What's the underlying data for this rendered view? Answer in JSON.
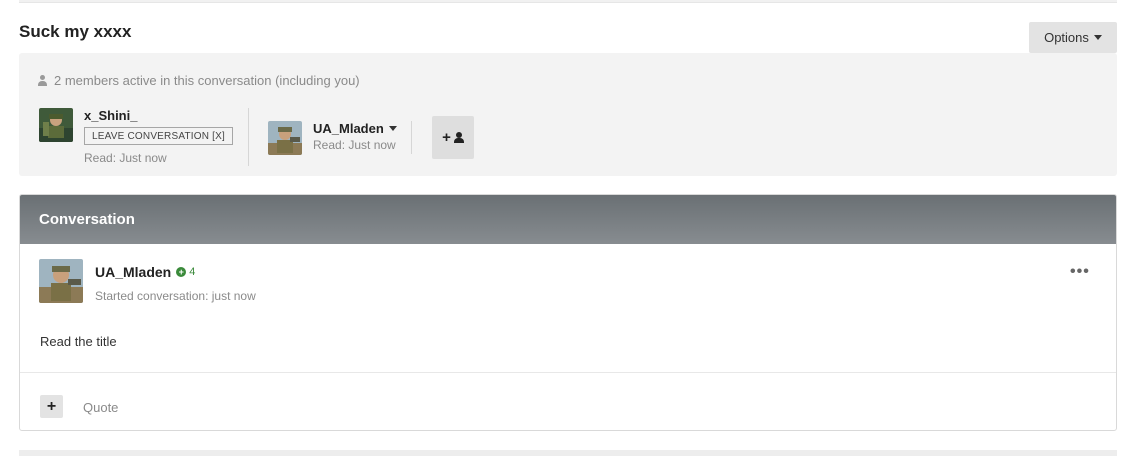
{
  "page": {
    "title": "Suck my xxxx"
  },
  "toolbar": {
    "options_label": "Options"
  },
  "participants": {
    "summary": "2 members active in this conversation (including you)",
    "members": [
      {
        "name": "x_Shini_",
        "action_label": "LEAVE CONVERSATION [X]",
        "read_status": "Read: Just now"
      },
      {
        "name": "UA_Mladen",
        "read_status": "Read: Just now"
      }
    ],
    "add_member_label": "+"
  },
  "conversation": {
    "header": "Conversation",
    "post": {
      "author": "UA_Mladen",
      "reputation": "4",
      "meta": "Started conversation: just now",
      "body": "Read the title",
      "menu_label": "•••",
      "quote_label": "Quote",
      "multiquote_label": "+"
    }
  },
  "colors": {
    "header_gradient_top": "#6a7074",
    "header_gradient_bottom": "#878c90",
    "reputation": "#3a8a3a"
  },
  "icons": [
    "user-icon",
    "caret-down-icon",
    "add-user-icon",
    "reputation-plus-icon",
    "more-horizontal-icon",
    "plus-icon"
  ]
}
